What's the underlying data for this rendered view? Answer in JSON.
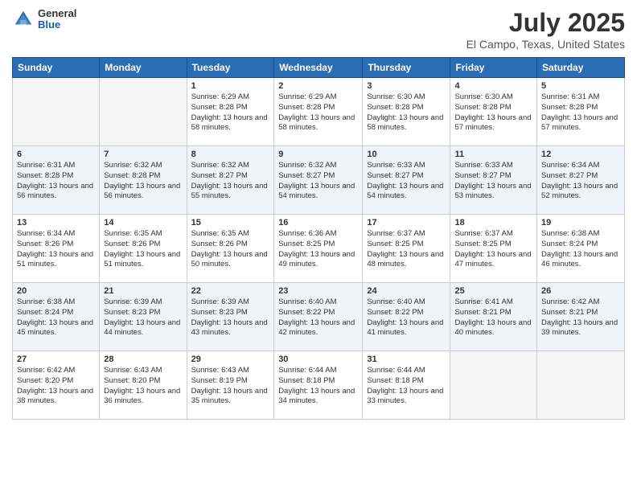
{
  "header": {
    "logo_general": "General",
    "logo_blue": "Blue",
    "title": "July 2025",
    "location": "El Campo, Texas, United States"
  },
  "days_of_week": [
    "Sunday",
    "Monday",
    "Tuesday",
    "Wednesday",
    "Thursday",
    "Friday",
    "Saturday"
  ],
  "weeks": [
    [
      {
        "day": null
      },
      {
        "day": null
      },
      {
        "day": 1,
        "sunrise": "Sunrise: 6:29 AM",
        "sunset": "Sunset: 8:28 PM",
        "daylight": "Daylight: 13 hours and 58 minutes."
      },
      {
        "day": 2,
        "sunrise": "Sunrise: 6:29 AM",
        "sunset": "Sunset: 8:28 PM",
        "daylight": "Daylight: 13 hours and 58 minutes."
      },
      {
        "day": 3,
        "sunrise": "Sunrise: 6:30 AM",
        "sunset": "Sunset: 8:28 PM",
        "daylight": "Daylight: 13 hours and 58 minutes."
      },
      {
        "day": 4,
        "sunrise": "Sunrise: 6:30 AM",
        "sunset": "Sunset: 8:28 PM",
        "daylight": "Daylight: 13 hours and 57 minutes."
      },
      {
        "day": 5,
        "sunrise": "Sunrise: 6:31 AM",
        "sunset": "Sunset: 8:28 PM",
        "daylight": "Daylight: 13 hours and 57 minutes."
      }
    ],
    [
      {
        "day": 6,
        "sunrise": "Sunrise: 6:31 AM",
        "sunset": "Sunset: 8:28 PM",
        "daylight": "Daylight: 13 hours and 56 minutes."
      },
      {
        "day": 7,
        "sunrise": "Sunrise: 6:32 AM",
        "sunset": "Sunset: 8:28 PM",
        "daylight": "Daylight: 13 hours and 56 minutes."
      },
      {
        "day": 8,
        "sunrise": "Sunrise: 6:32 AM",
        "sunset": "Sunset: 8:27 PM",
        "daylight": "Daylight: 13 hours and 55 minutes."
      },
      {
        "day": 9,
        "sunrise": "Sunrise: 6:32 AM",
        "sunset": "Sunset: 8:27 PM",
        "daylight": "Daylight: 13 hours and 54 minutes."
      },
      {
        "day": 10,
        "sunrise": "Sunrise: 6:33 AM",
        "sunset": "Sunset: 8:27 PM",
        "daylight": "Daylight: 13 hours and 54 minutes."
      },
      {
        "day": 11,
        "sunrise": "Sunrise: 6:33 AM",
        "sunset": "Sunset: 8:27 PM",
        "daylight": "Daylight: 13 hours and 53 minutes."
      },
      {
        "day": 12,
        "sunrise": "Sunrise: 6:34 AM",
        "sunset": "Sunset: 8:27 PM",
        "daylight": "Daylight: 13 hours and 52 minutes."
      }
    ],
    [
      {
        "day": 13,
        "sunrise": "Sunrise: 6:34 AM",
        "sunset": "Sunset: 8:26 PM",
        "daylight": "Daylight: 13 hours and 51 minutes."
      },
      {
        "day": 14,
        "sunrise": "Sunrise: 6:35 AM",
        "sunset": "Sunset: 8:26 PM",
        "daylight": "Daylight: 13 hours and 51 minutes."
      },
      {
        "day": 15,
        "sunrise": "Sunrise: 6:35 AM",
        "sunset": "Sunset: 8:26 PM",
        "daylight": "Daylight: 13 hours and 50 minutes."
      },
      {
        "day": 16,
        "sunrise": "Sunrise: 6:36 AM",
        "sunset": "Sunset: 8:25 PM",
        "daylight": "Daylight: 13 hours and 49 minutes."
      },
      {
        "day": 17,
        "sunrise": "Sunrise: 6:37 AM",
        "sunset": "Sunset: 8:25 PM",
        "daylight": "Daylight: 13 hours and 48 minutes."
      },
      {
        "day": 18,
        "sunrise": "Sunrise: 6:37 AM",
        "sunset": "Sunset: 8:25 PM",
        "daylight": "Daylight: 13 hours and 47 minutes."
      },
      {
        "day": 19,
        "sunrise": "Sunrise: 6:38 AM",
        "sunset": "Sunset: 8:24 PM",
        "daylight": "Daylight: 13 hours and 46 minutes."
      }
    ],
    [
      {
        "day": 20,
        "sunrise": "Sunrise: 6:38 AM",
        "sunset": "Sunset: 8:24 PM",
        "daylight": "Daylight: 13 hours and 45 minutes."
      },
      {
        "day": 21,
        "sunrise": "Sunrise: 6:39 AM",
        "sunset": "Sunset: 8:23 PM",
        "daylight": "Daylight: 13 hours and 44 minutes."
      },
      {
        "day": 22,
        "sunrise": "Sunrise: 6:39 AM",
        "sunset": "Sunset: 8:23 PM",
        "daylight": "Daylight: 13 hours and 43 minutes."
      },
      {
        "day": 23,
        "sunrise": "Sunrise: 6:40 AM",
        "sunset": "Sunset: 8:22 PM",
        "daylight": "Daylight: 13 hours and 42 minutes."
      },
      {
        "day": 24,
        "sunrise": "Sunrise: 6:40 AM",
        "sunset": "Sunset: 8:22 PM",
        "daylight": "Daylight: 13 hours and 41 minutes."
      },
      {
        "day": 25,
        "sunrise": "Sunrise: 6:41 AM",
        "sunset": "Sunset: 8:21 PM",
        "daylight": "Daylight: 13 hours and 40 minutes."
      },
      {
        "day": 26,
        "sunrise": "Sunrise: 6:42 AM",
        "sunset": "Sunset: 8:21 PM",
        "daylight": "Daylight: 13 hours and 39 minutes."
      }
    ],
    [
      {
        "day": 27,
        "sunrise": "Sunrise: 6:42 AM",
        "sunset": "Sunset: 8:20 PM",
        "daylight": "Daylight: 13 hours and 38 minutes."
      },
      {
        "day": 28,
        "sunrise": "Sunrise: 6:43 AM",
        "sunset": "Sunset: 8:20 PM",
        "daylight": "Daylight: 13 hours and 36 minutes."
      },
      {
        "day": 29,
        "sunrise": "Sunrise: 6:43 AM",
        "sunset": "Sunset: 8:19 PM",
        "daylight": "Daylight: 13 hours and 35 minutes."
      },
      {
        "day": 30,
        "sunrise": "Sunrise: 6:44 AM",
        "sunset": "Sunset: 8:18 PM",
        "daylight": "Daylight: 13 hours and 34 minutes."
      },
      {
        "day": 31,
        "sunrise": "Sunrise: 6:44 AM",
        "sunset": "Sunset: 8:18 PM",
        "daylight": "Daylight: 13 hours and 33 minutes."
      },
      {
        "day": null
      },
      {
        "day": null
      }
    ]
  ]
}
